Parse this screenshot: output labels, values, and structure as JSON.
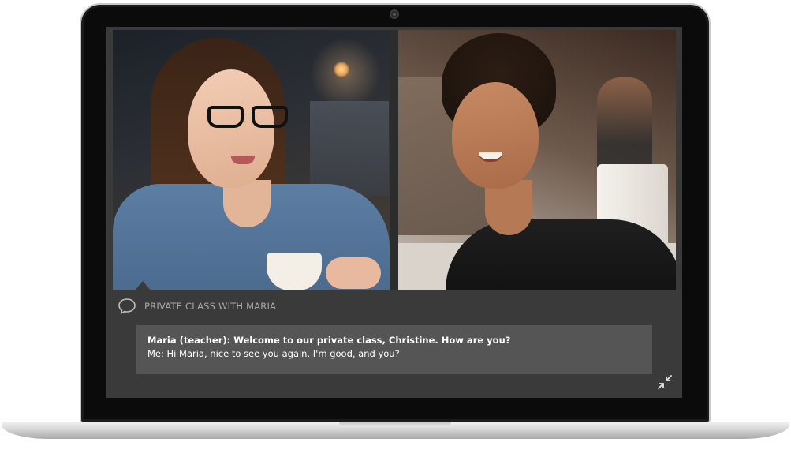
{
  "chat": {
    "title": "PRIVATE CLASS WITH MARIA",
    "messages": [
      {
        "sender": "teacher",
        "text": "Maria (teacher): Welcome to our private class, Christine. How are you?"
      },
      {
        "sender": "me",
        "text": "Me: Hi Maria, nice to see you again. I'm good, and you?"
      }
    ]
  },
  "icons": {
    "chat": "chat-bubble-icon",
    "minimize": "minimize-arrows-icon",
    "camera": "webcam-icon"
  },
  "colors": {
    "screen_bg": "#3a3a3a",
    "message_box_bg": "#555555",
    "header_text": "#a9a9a9",
    "message_text": "#ffffff"
  }
}
